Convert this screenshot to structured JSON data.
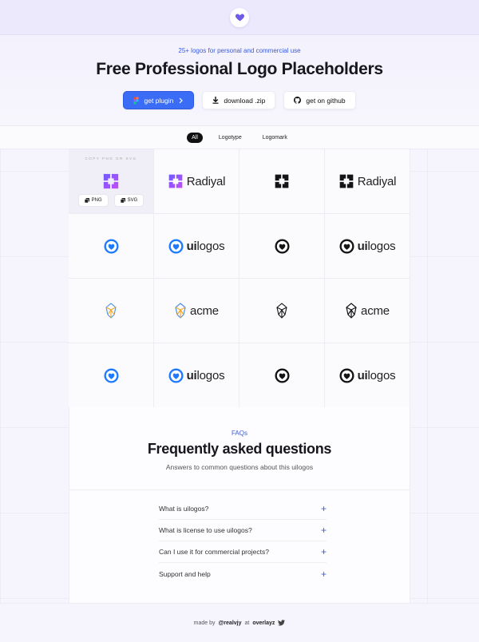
{
  "eyebrow": "25+ logos for personal and commercial use",
  "title": "Free Professional Logo Placeholders",
  "actions": {
    "plugin": "get plugin",
    "download": "download .zip",
    "github": "get on github"
  },
  "tabs": [
    "All",
    "Logotype",
    "Logomark"
  ],
  "hover_cell": {
    "copy_label": "COPY PNG OR SVG",
    "png": "PNG",
    "svg": "SVG"
  },
  "logos": {
    "radiyal": "Radiyal",
    "uilogos_ui": "ui",
    "uilogos_rest": "logos",
    "acme": "acme"
  },
  "faq": {
    "eyebrow": "FAQs",
    "title": "Frequently asked questions",
    "subtitle": "Answers to common questions about this uilogos",
    "items": [
      "What is uilogos?",
      "What is license to use uilogos?",
      "Can I use it for commercial projects?",
      "Support and help"
    ]
  },
  "footer": {
    "made_by": "made by",
    "author": "@realvjy",
    "at": "at",
    "company": "overlayz"
  },
  "colors": {
    "accent": "#3b6cf6",
    "heart": "#6c5ce7"
  }
}
